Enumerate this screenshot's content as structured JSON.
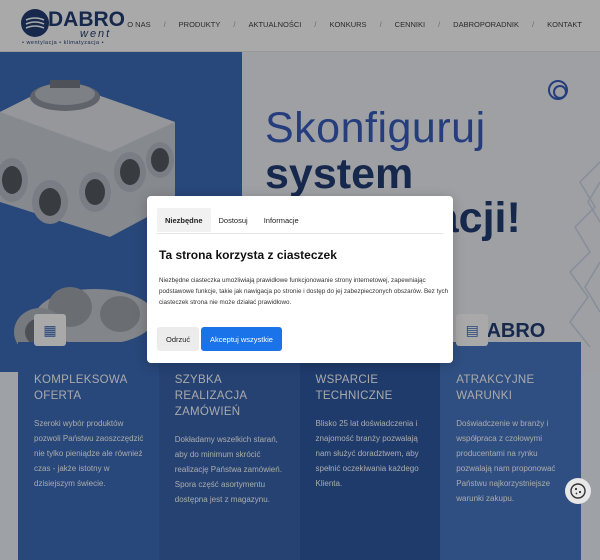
{
  "header": {
    "logo_text": "DABRO",
    "logo_sub": "went",
    "logo_tag": "• wentylacja • klimatyzacja •",
    "nav": [
      {
        "label": "O NAS"
      },
      {
        "label": "PRODUKTY"
      },
      {
        "label": "AKTUALNOŚCI"
      },
      {
        "label": "KONKURS"
      },
      {
        "label": "CENNIKI"
      },
      {
        "label": "DABROPORADNIK"
      },
      {
        "label": "KONTAKT"
      }
    ]
  },
  "hero": {
    "title_line1": "Skonfiguruj",
    "title_line2": "system",
    "title_line3": "racji!",
    "brand_bottom": "DABRO"
  },
  "features": [
    {
      "title": "KOMPLEKSOWA OFERTA",
      "text": "Szeroki wybór produktów pozwoli Państwu zaoszczędzić nie tylko pieniądze ale również czas - jakże istotny w dzisiejszym świecie."
    },
    {
      "title": "SZYBKA REALIZACJA ZAMÓWIEŃ",
      "text": "Dokładamy wszelkich starań, aby do minimum skrócić realizację Państwa zamówień. Spora część asortymentu dostępna jest z magazynu."
    },
    {
      "title": "WSPARCIE TECHNICZNE",
      "text": "Blisko 25 lat doświadczenia i znajomość branży pozwalają nam służyć doradztwem, aby spełnić oczekiwania każdego Klienta."
    },
    {
      "title": "ATRAKCYJNE WARUNKI",
      "text": "Doświadczenie w branży i współpraca z czołowymi producentami na rynku pozwalają nam proponować Państwu najkorzystniejsze warunki zakupu."
    }
  ],
  "modal": {
    "tabs": [
      {
        "label": "Niezbędne"
      },
      {
        "label": "Dostosuj"
      },
      {
        "label": "Informacje"
      }
    ],
    "title": "Ta strona korzysta z ciasteczek",
    "text": "Niezbędne ciasteczka umożliwiają prawidłowe funkcjonowanie strony internetowej, zapewniając podstawowe funkcje, takie jak nawigacja po stronie i dostęp do jej zabezpieczonych obszarów. Bez tych ciasteczek strona nie może działać prawidłowo.",
    "refuse_label": "Odrzuć",
    "accept_label": "Akceptuj wszystkie"
  },
  "colors": {
    "brand_blue": "#2f62b4",
    "brand_navy": "#14306b",
    "accept_blue": "#1a73e8"
  }
}
